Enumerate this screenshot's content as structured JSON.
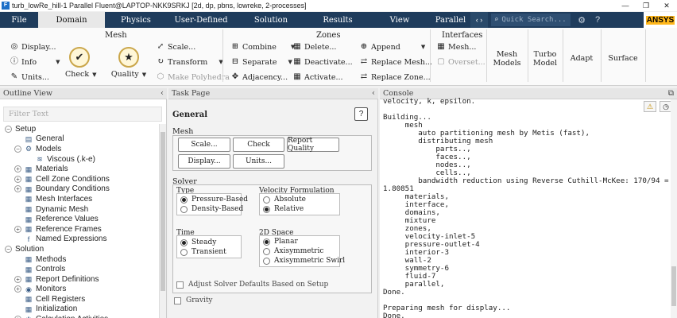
{
  "window": {
    "title": "turb_lowRe_hill-1 Parallel Fluent@LAPTOP-NKK9SRKJ  [2d, dp, pbns, lowreke, 2-processes]",
    "minimize": "—",
    "maximize": "❐",
    "close": "✕"
  },
  "tabs": [
    "File",
    "Domain",
    "Physics",
    "User-Defined",
    "Solution",
    "Results",
    "View",
    "Parallel"
  ],
  "active_tab": "Domain",
  "search_placeholder": "Quick Search...",
  "brand": "ANSYS",
  "ribbon": {
    "mesh_title": "Mesh",
    "display": "Display...",
    "info": "Info",
    "units": "Units...",
    "check": "Check",
    "quality": "Quality",
    "scale": "Scale...",
    "transform": "Transform",
    "make_polyhedra": "Make Polyhedra",
    "zones_title": "Zones",
    "combine": "Combine",
    "separate": "Separate",
    "adjacency": "Adjacency...",
    "delete": "Delete...",
    "deactivate": "Deactivate...",
    "activate": "Activate...",
    "append": "Append",
    "replace_mesh": "Replace Mesh...",
    "replace_zone": "Replace Zone...",
    "interfaces_title": "Interfaces",
    "mesh": "Mesh...",
    "overset": "Overset...",
    "mesh_models": "Mesh Models",
    "turbo_model": "Turbo Model",
    "adapt": "Adapt",
    "surface": "Surface"
  },
  "outline": {
    "title": "Outline View",
    "filter_placeholder": "Filter Text",
    "items": [
      {
        "label": "Setup",
        "level": 0,
        "toggle": "−",
        "icon": ""
      },
      {
        "label": "General",
        "level": 1,
        "toggle": "",
        "icon": "▤"
      },
      {
        "label": "Models",
        "level": 1,
        "toggle": "−",
        "icon": "⚙"
      },
      {
        "label": "Viscous (.k-e)",
        "level": 2,
        "toggle": "",
        "icon": "≋"
      },
      {
        "label": "Materials",
        "level": 1,
        "toggle": "+",
        "icon": "▦"
      },
      {
        "label": "Cell Zone Conditions",
        "level": 1,
        "toggle": "+",
        "icon": "▦"
      },
      {
        "label": "Boundary Conditions",
        "level": 1,
        "toggle": "+",
        "icon": "▦"
      },
      {
        "label": "Mesh Interfaces",
        "level": 1,
        "toggle": "",
        "icon": "▦"
      },
      {
        "label": "Dynamic Mesh",
        "level": 1,
        "toggle": "",
        "icon": "▦"
      },
      {
        "label": "Reference Values",
        "level": 1,
        "toggle": "",
        "icon": "▦"
      },
      {
        "label": "Reference Frames",
        "level": 1,
        "toggle": "+",
        "icon": "▦"
      },
      {
        "label": "Named Expressions",
        "level": 1,
        "toggle": "",
        "icon": "f"
      },
      {
        "label": "Solution",
        "level": 0,
        "toggle": "−",
        "icon": ""
      },
      {
        "label": "Methods",
        "level": 1,
        "toggle": "",
        "icon": "▦"
      },
      {
        "label": "Controls",
        "level": 1,
        "toggle": "",
        "icon": "▦"
      },
      {
        "label": "Report Definitions",
        "level": 1,
        "toggle": "+",
        "icon": "▦"
      },
      {
        "label": "Monitors",
        "level": 1,
        "toggle": "+",
        "icon": "◉"
      },
      {
        "label": "Cell Registers",
        "level": 1,
        "toggle": "",
        "icon": "▦"
      },
      {
        "label": "Initialization",
        "level": 1,
        "toggle": "",
        "icon": "▦"
      },
      {
        "label": "Calculation Activities",
        "level": 1,
        "toggle": "+",
        "icon": "✱"
      }
    ]
  },
  "task": {
    "title": "Task Page",
    "page": "General",
    "help": "?",
    "mesh": {
      "title": "Mesh",
      "scale": "Scale...",
      "check": "Check",
      "report_quality": "Report Quality",
      "display": "Display...",
      "units": "Units..."
    },
    "solver": {
      "title": "Solver",
      "type_label": "Type",
      "pressure_based": "Pressure-Based",
      "density_based": "Density-Based",
      "type_selected": "Pressure-Based",
      "vel_label": "Velocity Formulation",
      "absolute": "Absolute",
      "relative": "Relative",
      "vel_selected": "Relative",
      "time_label": "Time",
      "steady": "Steady",
      "transient": "Transient",
      "time_selected": "Steady",
      "space_label": "2D Space",
      "planar": "Planar",
      "axisymmetric": "Axisymmetric",
      "axisymmetric_swirl": "Axisymmetric Swirl",
      "space_selected": "Planar",
      "adjust_defaults": "Adjust Solver Defaults Based on Setup"
    },
    "gravity": "Gravity"
  },
  "console": {
    "title": "Console",
    "text": "velocity, k, epsilon.\n\nBuilding...\n     mesh\n        auto partitioning mesh by Metis (fast),\n        distributing mesh\n            parts..,\n            faces..,\n            nodes..,\n            cells..,\n        bandwidth reduction using Reverse Cuthill-McKee: 170/94 =\n1.80851\n     materials,\n     interface,\n     domains,\n     mixture\n     zones,\n     velocity-inlet-5\n     pressure-outlet-4\n     interior-3\n     wall-2\n     symmetry-6\n     fluid-7\n     parallel,\nDone.\n\nPreparing mesh for display...\nDone."
  }
}
